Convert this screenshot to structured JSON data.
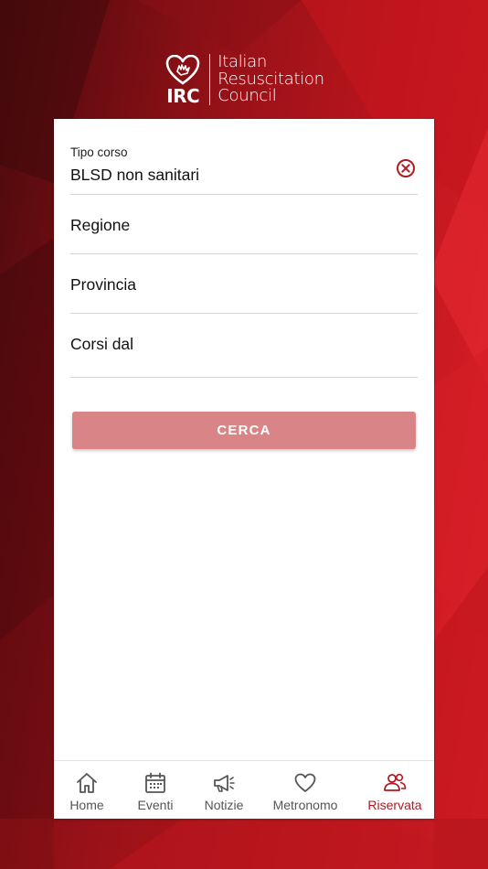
{
  "brand": {
    "logo_short": "IRC",
    "logo_lines": [
      "Italian",
      "Resuscitation",
      "Council"
    ],
    "accent_color": "#b01a22"
  },
  "form": {
    "course_type": {
      "label": "Tipo corso",
      "value": "BLSD non sanitari",
      "clear_icon": "close-circle-icon"
    },
    "region": {
      "placeholder": "Regione"
    },
    "province": {
      "placeholder": "Provincia"
    },
    "courses_from": {
      "placeholder": "Corsi dal"
    },
    "search_label": "CERCA"
  },
  "nav": {
    "items": [
      {
        "label": "Home",
        "icon": "home-icon",
        "active": false
      },
      {
        "label": "Eventi",
        "icon": "calendar-icon",
        "active": false
      },
      {
        "label": "Notizie",
        "icon": "megaphone-icon",
        "active": false
      },
      {
        "label": "Metronomo",
        "icon": "heart-icon",
        "active": false
      },
      {
        "label": "Riservata",
        "icon": "users-icon",
        "active": true
      }
    ]
  }
}
